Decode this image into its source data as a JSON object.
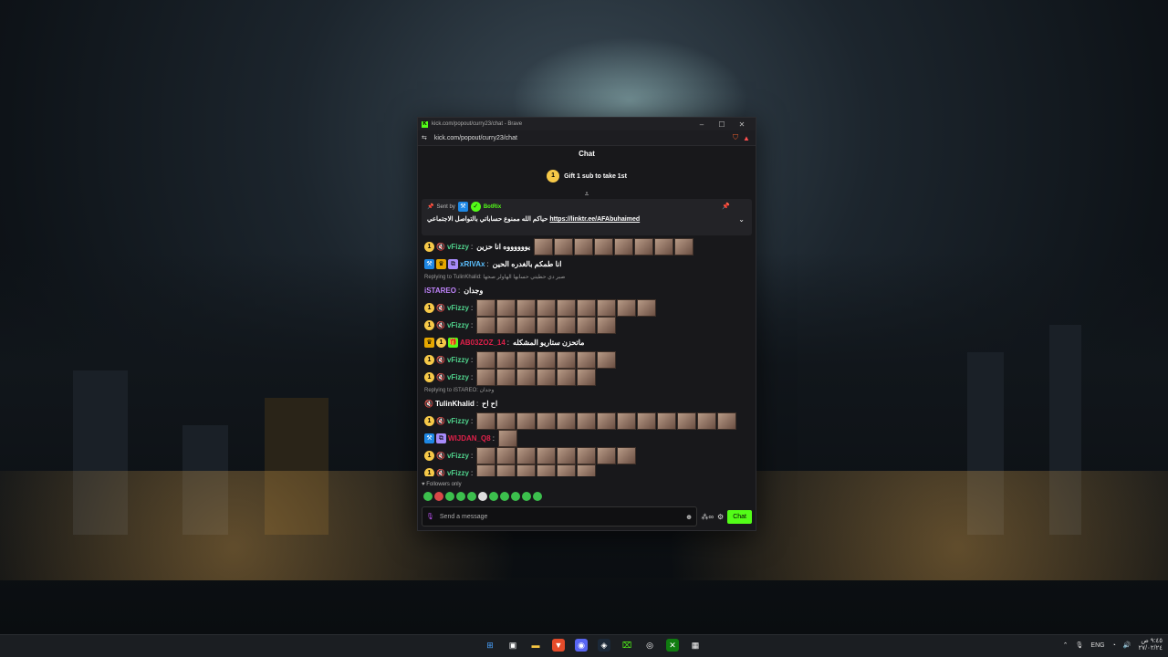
{
  "window": {
    "title": "kick.com/popout/curry23/chat - Brave",
    "url": "kick.com/popout/curry23/chat",
    "controls": [
      "–",
      "☐",
      "✕"
    ]
  },
  "chat": {
    "header": "Chat",
    "gift": {
      "coin": "1",
      "label": "Gift 1 sub to take 1st"
    },
    "pinned": {
      "sent_by": "Sent by",
      "bot": "BotRix",
      "message": "حياكم الله ممنوع حساباتي بالتواصل الاجتماعي",
      "link": "https://linktr.ee/AFAbuhaimed"
    },
    "messages": [
      {
        "user": "vFizzy",
        "color": "#4fd18b",
        "text": "يووووووه انا حزين",
        "emotes": 8,
        "badges": [
          "coin",
          "mute"
        ]
      },
      {
        "user": "xRIVAx",
        "color": "#5bc0ff",
        "text": "انا طمكم بالغدره الحين",
        "emotes": 0,
        "badges": [
          "mod",
          "crown",
          "sub"
        ]
      },
      {
        "reply": "Replying to TulinKhalid: صبر دي حطيتي حسابها الهاولر صحها"
      },
      {
        "user": "iSTAREO",
        "color": "#c084fc",
        "text": "وجدان",
        "emotes": 0,
        "badges": []
      },
      {
        "user": "vFizzy",
        "color": "#4fd18b",
        "text": "",
        "emotes": 9,
        "badges": [
          "coin",
          "mute"
        ]
      },
      {
        "user": "vFizzy",
        "color": "#4fd18b",
        "text": "",
        "emotes": 7,
        "badges": [
          "coin",
          "mute"
        ]
      },
      {
        "user": "AB03ZOZ_14",
        "color": "#e0204a",
        "text": "ماتحزن ستاريو المشكله",
        "emotes": 0,
        "badges": [
          "crown",
          "coin",
          "gift"
        ]
      },
      {
        "user": "vFizzy",
        "color": "#4fd18b",
        "text": "",
        "emotes": 7,
        "badges": [
          "coin",
          "mute"
        ]
      },
      {
        "user": "vFizzy",
        "color": "#4fd18b",
        "text": "",
        "emotes": 6,
        "badges": [
          "coin",
          "mute"
        ]
      },
      {
        "reply": "Replying to iSTAREO: وجدان"
      },
      {
        "user": "TulinKhalid",
        "color": "#ffffff",
        "text": "اح اح",
        "emotes": 0,
        "badges": [
          "mute"
        ]
      },
      {
        "user": "vFizzy",
        "color": "#4fd18b",
        "text": "",
        "emotes": 13,
        "badges": [
          "coin",
          "mute"
        ]
      },
      {
        "user": "WIJDAN_Q8",
        "color": "#e0204a",
        "text": "",
        "emotes": 1,
        "badges": [
          "mod",
          "sub"
        ]
      },
      {
        "user": "vFizzy",
        "color": "#4fd18b",
        "text": "",
        "emotes": 8,
        "badges": [
          "coin",
          "mute"
        ]
      },
      {
        "user": "vFizzy",
        "color": "#4fd18b",
        "text": "",
        "emotes": 6,
        "badges": [
          "coin",
          "mute"
        ]
      }
    ],
    "followers_only": "Followers only",
    "input_placeholder": "Send a message",
    "send_button": "Chat"
  },
  "taskbar": {
    "lang": "ENG",
    "time": "٩:٤٥ ص",
    "date": "٢٧/٠٢/٢٤"
  }
}
